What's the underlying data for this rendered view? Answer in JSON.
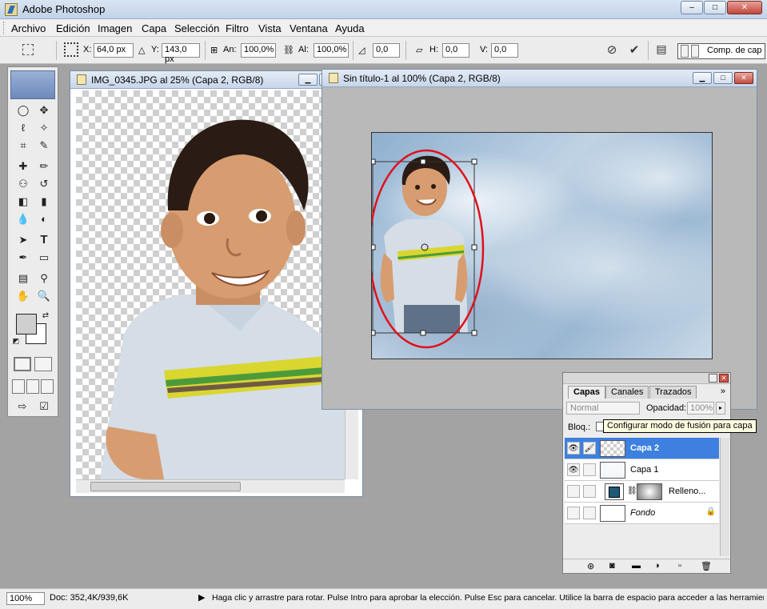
{
  "app": {
    "title": "Adobe Photoshop",
    "window_buttons": [
      "–",
      "□",
      "✕"
    ]
  },
  "menu": [
    "Archivo",
    "Edición",
    "Imagen",
    "Capa",
    "Selección",
    "Filtro",
    "Vista",
    "Ventana",
    "Ayuda"
  ],
  "options": {
    "x_label": "X:",
    "x_value": "64,0 px",
    "y_label": "Y:",
    "y_value": "143,0 px",
    "w_label": "An:",
    "w_value": "100,0%",
    "h_label": "Al:",
    "h_value": "100,0%",
    "angle_value": "0,0",
    "hskew_label": "H:",
    "hskew_value": "0,0",
    "vskew_label": "V:",
    "vskew_value": "0,0",
    "cancel_icon": "cancel-circle-icon",
    "commit_icon": "checkmark-icon",
    "comps_label": "Comp. de cap"
  },
  "doc1": {
    "title": "IMG_0345.JPG al 25% (Capa 2, RGB/8)"
  },
  "doc2": {
    "title": "Sin título-1 al 100% (Capa 2, RGB/8)"
  },
  "layers_panel": {
    "tabs": [
      "Capas",
      "Canales",
      "Trazados"
    ],
    "blend_mode": "Normal",
    "opacity_label": "Opacidad:",
    "opacity_value": "100%",
    "lock_label": "Bloq.:",
    "tooltip": "Configurar modo de fusión para capa",
    "layers": [
      {
        "name": "Capa 2",
        "visible": true,
        "selected": true
      },
      {
        "name": "Capa 1",
        "visible": true,
        "selected": false
      },
      {
        "name": "Relleno...",
        "visible": false,
        "selected": false
      },
      {
        "name": "Fondo",
        "visible": false,
        "selected": false,
        "locked": true
      }
    ]
  },
  "status": {
    "zoom": "100%",
    "doc_size": "Doc: 352,4K/939,6K",
    "hint": "Haga clic y arrastre para rotar. Pulse Intro para aprobar la elección. Pulse Esc para cancelar. Utilice la barra de espacio para acceder a las herramientas de"
  },
  "colors": {
    "selection_blue": "#3d80df",
    "ellipse_red": "#e0101a",
    "workspace_gray": "#a3a3a3"
  }
}
